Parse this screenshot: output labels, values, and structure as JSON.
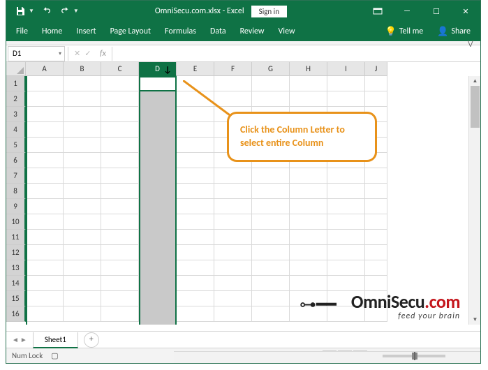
{
  "titlebar": {
    "title": "OmniSecu.com.xlsx - Excel",
    "signin": "Sign in"
  },
  "tabs": {
    "file": "File",
    "home": "Home",
    "insert": "Insert",
    "layout": "Page Layout",
    "formulas": "Formulas",
    "data": "Data",
    "review": "Review",
    "view": "View",
    "tellme": "Tell me",
    "share": "Share"
  },
  "formula": {
    "namebox": "D1",
    "fx": "fx"
  },
  "columns": [
    "A",
    "B",
    "C",
    "D",
    "E",
    "F",
    "G",
    "H",
    "I",
    "J"
  ],
  "selected_column_index": 3,
  "rows": [
    "1",
    "2",
    "3",
    "4",
    "5",
    "6",
    "7",
    "8",
    "9",
    "10",
    "11",
    "12",
    "13",
    "14",
    "15",
    "16"
  ],
  "sheet": {
    "active": "Sheet1"
  },
  "status": {
    "numlock": "Num Lock",
    "zoom": "100%"
  },
  "callout": {
    "text": "Click the Column Letter to select entire Column"
  },
  "logo": {
    "brand_a": "Omni",
    "brand_b": "Secu",
    "brand_c": ".com",
    "tag": "feed your brain"
  }
}
